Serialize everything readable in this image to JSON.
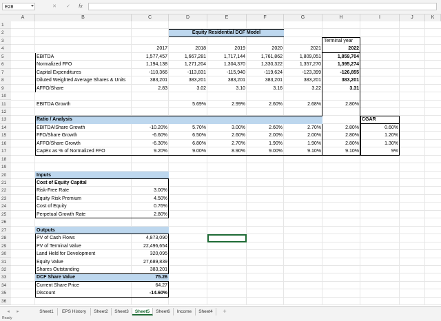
{
  "formula_bar": {
    "name_box": "E28",
    "cancel_icon": "✕",
    "enter_icon": "✓",
    "fx_label": "fx",
    "formula": ""
  },
  "columns": [
    "A",
    "B",
    "C",
    "D",
    "E",
    "F",
    "G",
    "H",
    "I",
    "J",
    "K"
  ],
  "rows": [
    "1",
    "2",
    "3",
    "4",
    "5",
    "6",
    "7",
    "8",
    "9",
    "10",
    "11",
    "12",
    "13",
    "14",
    "15",
    "16",
    "17",
    "18",
    "19",
    "20",
    "21",
    "22",
    "23",
    "24",
    "25",
    "26",
    "27",
    "28",
    "29",
    "30",
    "31",
    "32",
    "33",
    "34",
    "35",
    "36"
  ],
  "sheet": {
    "title": "Equity Residential DCF Model",
    "terminal_year_label": "Terminal year",
    "years": [
      "2017",
      "2018",
      "2019",
      "2020",
      "2021",
      "2022"
    ],
    "metrics": [
      {
        "label": "EBITDA",
        "values": [
          "1,577,457",
          "1,667,281",
          "1,717,144",
          "1,761,862",
          "1,809,051",
          "1,859,704"
        ]
      },
      {
        "label": "Normalized FFO",
        "values": [
          "1,194,138",
          "1,271,204",
          "1,304,370",
          "1,330,322",
          "1,357,270",
          "1,395,274"
        ]
      },
      {
        "label": "Capital Expenditures",
        "values": [
          "-110,366",
          "-113,831",
          "-115,940",
          "-119,624",
          "-123,399",
          "-126,855"
        ]
      },
      {
        "label": "Diluted Weighted Average Shares & Units",
        "values": [
          "383,201",
          "383,201",
          "383,201",
          "383,201",
          "383,201",
          "383,201"
        ]
      },
      {
        "label": "AFFO/Share",
        "values": [
          "2.83",
          "3.02",
          "3.10",
          "3.16",
          "3.22",
          "3.31"
        ]
      }
    ],
    "ebitda_growth": {
      "label": "EBITDA Growth",
      "values": [
        "",
        "5.69%",
        "2.99%",
        "2.60%",
        "2.68%",
        "2.80%"
      ]
    },
    "ratio_header": "Ratio / Analysis",
    "cagr_label": "CGAR",
    "ratios": [
      {
        "label": "EBITDA/Share Growth",
        "values": [
          "-10.20%",
          "5.70%",
          "3.00%",
          "2.60%",
          "2.70%",
          "2.80%"
        ],
        "cagr": "0.60%"
      },
      {
        "label": "FFO/Share Growth",
        "values": [
          "-6.60%",
          "6.50%",
          "2.60%",
          "2.00%",
          "2.00%",
          "2.80%"
        ],
        "cagr": "1.20%"
      },
      {
        "label": "AFFO/Share Growth",
        "values": [
          "-6.30%",
          "6.80%",
          "2.70%",
          "1.90%",
          "1.90%",
          "2.80%"
        ],
        "cagr": "1.30%"
      },
      {
        "label": "CapEx as % of Normalized FFO",
        "values": [
          "9.20%",
          "9.00%",
          "8.90%",
          "9.00%",
          "9.10%",
          "9.10%"
        ],
        "cagr": "9%"
      }
    ],
    "inputs": {
      "header": "Inputs",
      "subheader": "Cost of Equity Capital",
      "items": [
        {
          "label": "Risk-Free Rate",
          "value": "3.00%"
        },
        {
          "label": "Equity Risk Premium",
          "value": "4.50%"
        },
        {
          "label": "Cost of Equity",
          "value": "0.76%"
        },
        {
          "label": "Perpetual Growth Rate",
          "value": "2.80%"
        }
      ]
    },
    "outputs": {
      "header": "Outputs",
      "items": [
        {
          "label": "PV of Cash Flows",
          "value": "4,873,090"
        },
        {
          "label": "PV of Terminal Value",
          "value": "22,496,654"
        },
        {
          "label": "Land Held for Development",
          "value": "320,095"
        },
        {
          "label": "Equity Value",
          "value": "27,689,839"
        },
        {
          "label": "Shares Outstanding",
          "value": "383,201"
        },
        {
          "label": "DCF Share Value",
          "value": "75.26"
        },
        {
          "label": "Current Share Price",
          "value": "64.27"
        },
        {
          "label": "Discount",
          "value": "-14.60%"
        }
      ]
    }
  },
  "tabs": [
    "Sheet1",
    "EPS History",
    "Sheet2",
    "Sheet3",
    "Sheet5",
    "Sheet6",
    "Income",
    "Sheet4"
  ],
  "active_tab": "Sheet5",
  "add_sheet_icon": "+",
  "status": "Ready",
  "colors": {
    "highlight": "#bdd7ee",
    "active_tab": "#1e6b35"
  }
}
